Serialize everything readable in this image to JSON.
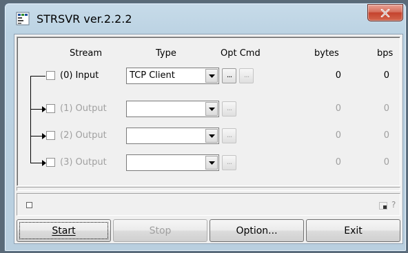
{
  "window": {
    "title": "STRSVR ver.2.2.2",
    "close_label": "X"
  },
  "headers": {
    "stream": "Stream",
    "type": "Type",
    "opt_cmd": "Opt Cmd",
    "bytes": "bytes",
    "bps": "bps"
  },
  "rows": [
    {
      "label": "(0) Input",
      "type_value": "TCP Client",
      "opt_label": "...",
      "cmd_label": "...",
      "bytes": "0",
      "bps": "0"
    },
    {
      "label": "(1) Output",
      "type_value": "",
      "opt_label": "...",
      "bytes": "0",
      "bps": "0"
    },
    {
      "label": "(2) Output",
      "type_value": "",
      "opt_label": "...",
      "bytes": "0",
      "bps": "0"
    },
    {
      "label": "(3) Output",
      "type_value": "",
      "opt_label": "...",
      "bytes": "0",
      "bps": "0"
    }
  ],
  "status": {
    "help_label": "?"
  },
  "buttons": {
    "start": "Start",
    "stop": "Stop",
    "option": "Option...",
    "exit": "Exit"
  },
  "colors": {
    "title_bar": "#bcd3e3",
    "close": "#c4432e",
    "disabled_text": "#a0a0a0"
  },
  "icons": [
    "app-icon",
    "close-icon",
    "dropdown-arrow-icon",
    "status-indicator-icon",
    "resize-grip-icon"
  ]
}
